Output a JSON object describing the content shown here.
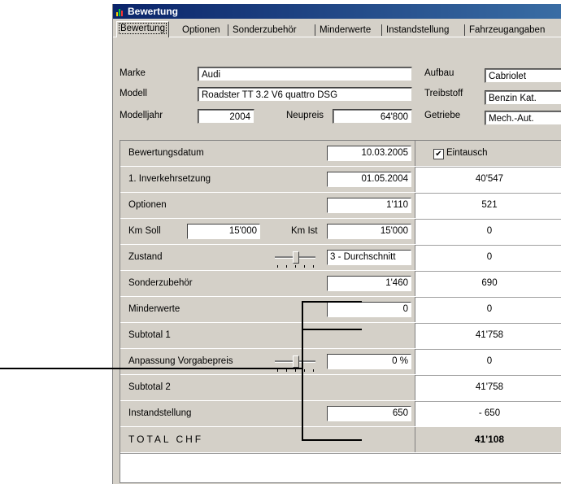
{
  "window": {
    "title": "Bewertung"
  },
  "tabs": [
    "Bewertung",
    "Optionen",
    "Sonderzubehör",
    "Minderwerte",
    "Instandstellung",
    "Fahrzeugangaben"
  ],
  "header": {
    "marke_label": "Marke",
    "marke": "Audi",
    "modell_label": "Modell",
    "modell": "Roadster TT 3.2 V6 quattro DSG",
    "modelljahr_label": "Modelljahr",
    "modelljahr": "2004",
    "neupreis_label": "Neupreis",
    "neupreis": "64'800",
    "aufbau_label": "Aufbau",
    "aufbau": "Cabriolet",
    "treibstoff_label": "Treibstoff",
    "treibstoff": "Benzin Kat.",
    "getriebe_label": "Getriebe",
    "getriebe": "Mech.-Aut."
  },
  "rows": {
    "bewertungsdatum": {
      "label": "Bewertungsdatum",
      "input": "10.03.2005",
      "eintausch_label": "Eintausch",
      "eintausch_checked": true
    },
    "inverkehr": {
      "label": "1. Inverkehrsetzung",
      "input": "01.05.2004",
      "value": "40'547"
    },
    "optionen": {
      "label": "Optionen",
      "input": "1'110",
      "value": "521"
    },
    "km": {
      "soll_label": "Km Soll",
      "soll": "15'000",
      "ist_label": "Km Ist",
      "ist": "15'000",
      "value": "0"
    },
    "zustand": {
      "label": "Zustand",
      "input": "3 - Durchschnitt",
      "value": "0",
      "slider_level": 0.5
    },
    "sonderzubehoer": {
      "label": "Sonderzubehör",
      "input": "1'460",
      "value": "690"
    },
    "minderwerte": {
      "label": "Minderwerte",
      "input": "0",
      "value": "0"
    },
    "subtotal1": {
      "label": "Subtotal 1",
      "value": "41'758"
    },
    "anpassung": {
      "label": "Anpassung Vorgabepreis",
      "input": "0 %",
      "value": "0",
      "slider_level": 0.5
    },
    "subtotal2": {
      "label": "Subtotal 2",
      "value": "41'758"
    },
    "instandstellung": {
      "label": "Instandstellung",
      "input": "650",
      "value": "- 650"
    },
    "total": {
      "label": "TOTAL CHF",
      "value": "41'108"
    }
  },
  "icons": {
    "app": "bar-chart-icon",
    "checkbox": "check-icon"
  }
}
